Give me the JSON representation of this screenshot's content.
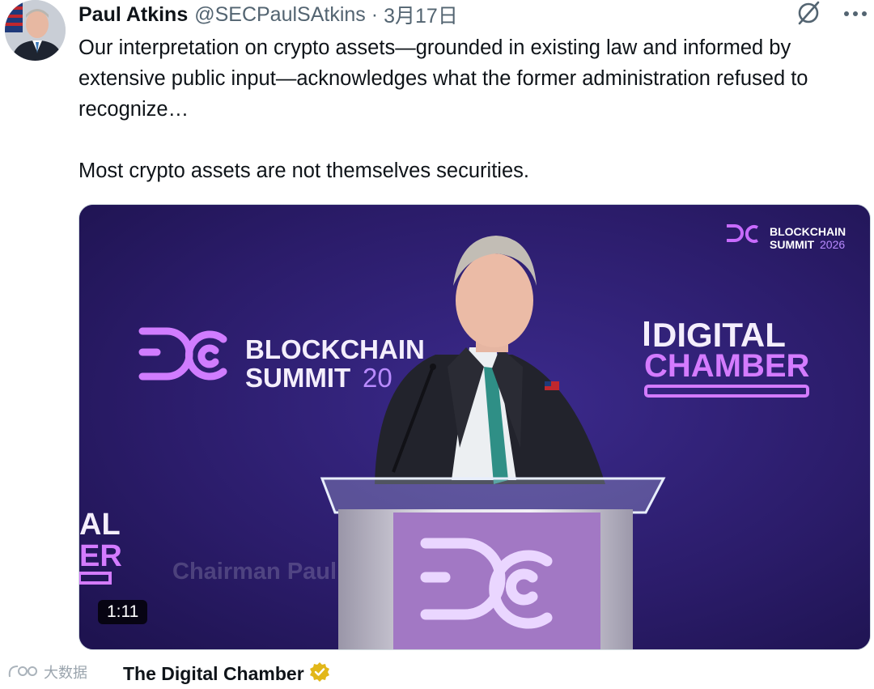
{
  "author": {
    "name": "Paul Atkins",
    "handle": "@SECPaulSAtkins",
    "separator": "·",
    "date": "3月17日"
  },
  "tweet": {
    "text": "Our interpretation on crypto assets—grounded in existing law and informed by extensive public input—acknowledges what the former administration refused to recognize…\n\nMost crypto assets are not themselves securities."
  },
  "media": {
    "duration": "1:11",
    "scene_text": {
      "corner_logo_line1": "BLOCKCHAIN",
      "corner_logo_line2": "SUMMIT",
      "corner_logo_year": "2026",
      "backdrop_line1": "BLOCKCHAIN",
      "backdrop_line2": "SUMMIT",
      "backdrop_year": "20",
      "digital_line1": "DIGITAL",
      "digital_line2": "CHAMBER",
      "lower_third": "Chairman Paul Atkins",
      "edge_line1": "AL",
      "edge_line2": "ER"
    }
  },
  "watermark": {
    "text": "大数据"
  },
  "source": {
    "name": "The Digital Chamber"
  },
  "icons": {
    "grok": "grok-icon",
    "more": "more-icon",
    "verified": "verified-badge-icon",
    "avatar": "avatar"
  },
  "colors": {
    "text": "#0f1419",
    "secondary": "#536471",
    "video_bg": "#2c1d6a",
    "neon": "#c86bff",
    "badge": "#e2b719"
  }
}
